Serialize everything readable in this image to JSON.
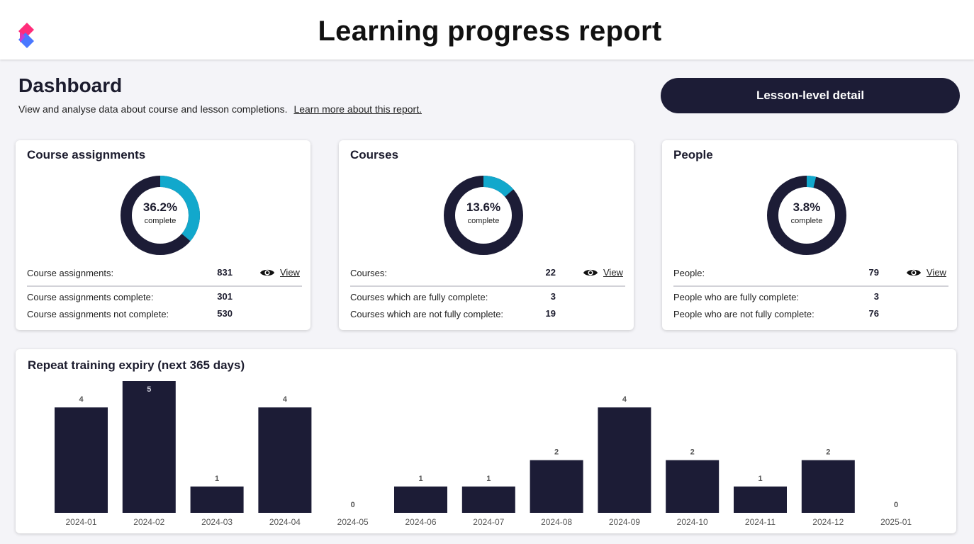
{
  "header": {
    "title": "Learning progress report",
    "logo_icon": "app-logo-icon"
  },
  "dashboard": {
    "title": "Dashboard",
    "subtitle": "View and analyse data about course and lesson completions.",
    "learn_more": "Learn more about this report.",
    "lesson_button": "Lesson-level detail"
  },
  "colors": {
    "accent": "#12a8cc",
    "dark": "#1c1c36",
    "bar": "#1c1c36"
  },
  "cards": [
    {
      "title": "Course assignments",
      "percent": "36.2%",
      "percent_value": 36.2,
      "complete_label": "complete",
      "total_label": "Course assignments:",
      "total_value": "831",
      "view_label": "View",
      "complete_row_label": "Course assignments complete:",
      "complete_row_value": "301",
      "incomplete_row_label": "Course assignments not complete:",
      "incomplete_row_value": "530"
    },
    {
      "title": "Courses",
      "percent": "13.6%",
      "percent_value": 13.6,
      "complete_label": "complete",
      "total_label": "Courses:",
      "total_value": "22",
      "view_label": "View",
      "complete_row_label": "Courses which are fully complete:",
      "complete_row_value": "3",
      "incomplete_row_label": "Courses which are not fully complete:",
      "incomplete_row_value": "19"
    },
    {
      "title": "People",
      "percent": "3.8%",
      "percent_value": 3.8,
      "complete_label": "complete",
      "total_label": "People:",
      "total_value": "79",
      "view_label": "View",
      "complete_row_label": "People who are fully complete:",
      "complete_row_value": "3",
      "incomplete_row_label": "People who are not fully complete:",
      "incomplete_row_value": "76"
    }
  ],
  "chart_title": "Repeat training expiry (next 365 days)",
  "chart_data": {
    "type": "bar",
    "title": "Repeat training expiry (next 365 days)",
    "categories": [
      "2024-01",
      "2024-02",
      "2024-03",
      "2024-04",
      "2024-05",
      "2024-06",
      "2024-07",
      "2024-08",
      "2024-09",
      "2024-10",
      "2024-11",
      "2024-12",
      "2025-01"
    ],
    "values": [
      4,
      5,
      1,
      4,
      0,
      1,
      1,
      2,
      4,
      2,
      1,
      2,
      0
    ],
    "ylim": [
      0,
      5
    ],
    "grid": false,
    "legend": "none"
  }
}
